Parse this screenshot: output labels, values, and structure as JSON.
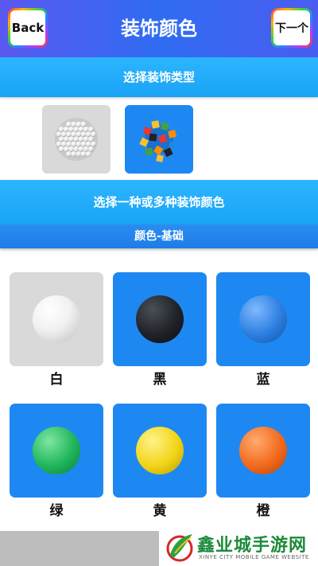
{
  "header": {
    "title": "装饰颜色",
    "back_label": "Back",
    "next_label": "下一个"
  },
  "section_type": {
    "label": "选择装饰类型",
    "options": [
      {
        "icon": "pearl-ball-icon",
        "selected": false
      },
      {
        "icon": "cube-cluster-icon",
        "selected": true
      }
    ]
  },
  "section_color": {
    "label": "选择一种或多种装饰颜色",
    "category": "颜色-基础",
    "swatches": [
      {
        "label": "白",
        "color": "#f2f2f2",
        "selected": false
      },
      {
        "label": "黑",
        "color": "#1f2227",
        "selected": true
      },
      {
        "label": "蓝",
        "color": "#2c7fe0",
        "selected": true
      },
      {
        "label": "绿",
        "color": "#1fb65a",
        "selected": true
      },
      {
        "label": "黄",
        "color": "#f2d416",
        "selected": true
      },
      {
        "label": "橙",
        "color": "#f26a1c",
        "selected": true
      }
    ]
  },
  "watermark": {
    "title": "鑫业城手游网",
    "subtitle": "XINYE CITY MOBILE GAME WEBSITE"
  }
}
